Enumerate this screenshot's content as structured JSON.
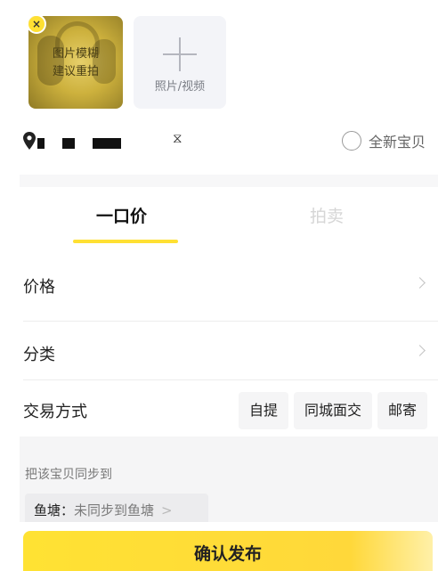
{
  "media": {
    "photo_overlay_line1": "图片模糊",
    "photo_overlay_line2": "建议重拍",
    "remove_symbol": "×",
    "add_label": "照片/视频"
  },
  "location": {
    "extra_symbol": "⧖",
    "new_item_label": "全新宝贝"
  },
  "tabs": {
    "fixed_price": "一口价",
    "auction": "拍卖"
  },
  "form": {
    "price_label": "价格",
    "category_label": "分类",
    "trade_label": "交易方式",
    "trade_options": [
      "自提",
      "同城面交",
      "邮寄"
    ]
  },
  "sync": {
    "title": "把该宝贝同步到",
    "channel_key": "鱼塘：",
    "channel_value": "未同步到鱼塘"
  },
  "publish_label": "确认发布",
  "colors": {
    "accent_yellow": "#ffe033",
    "muted_text": "#7a7a7a"
  }
}
